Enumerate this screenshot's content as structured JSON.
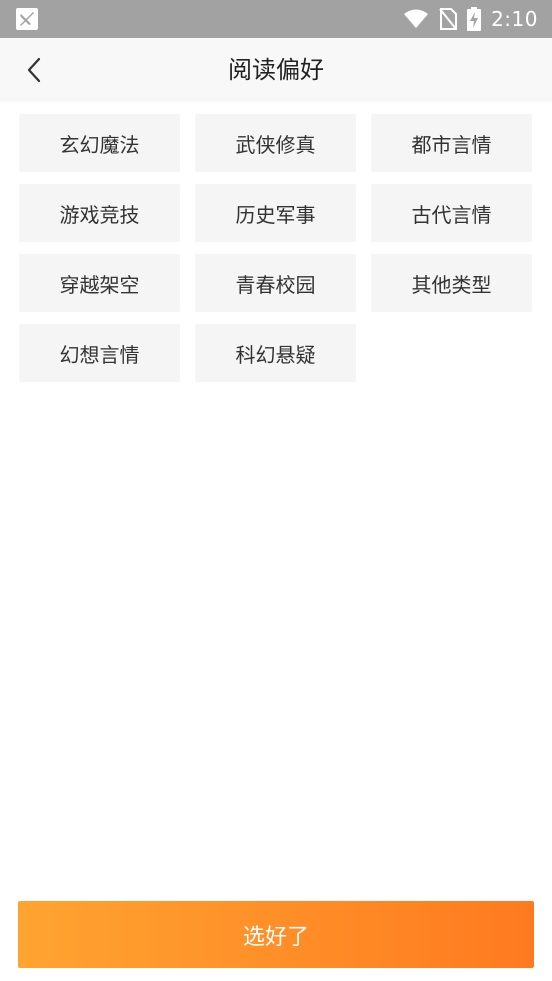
{
  "status_bar": {
    "time": "2:10",
    "icons": [
      "notification-app-icon",
      "wifi-icon",
      "no-sim-icon",
      "battery-charging-icon"
    ]
  },
  "header": {
    "title": "阅读偏好",
    "back_icon": "chevron-left-icon"
  },
  "categories": [
    {
      "label": "玄幻魔法"
    },
    {
      "label": "武侠修真"
    },
    {
      "label": "都市言情"
    },
    {
      "label": "游戏竞技"
    },
    {
      "label": "历史军事"
    },
    {
      "label": "古代言情"
    },
    {
      "label": "穿越架空"
    },
    {
      "label": "青春校园"
    },
    {
      "label": "其他类型"
    },
    {
      "label": "幻想言情"
    },
    {
      "label": "科幻悬疑"
    }
  ],
  "footer": {
    "confirm_label": "选好了"
  },
  "colors": {
    "status_bar_bg": "#a2a2a2",
    "nav_bg": "#f8f8f8",
    "tag_bg": "#f5f5f5",
    "tag_text": "#333333",
    "button_gradient_start": "#ffa431",
    "button_gradient_end": "#ff7a1f"
  }
}
